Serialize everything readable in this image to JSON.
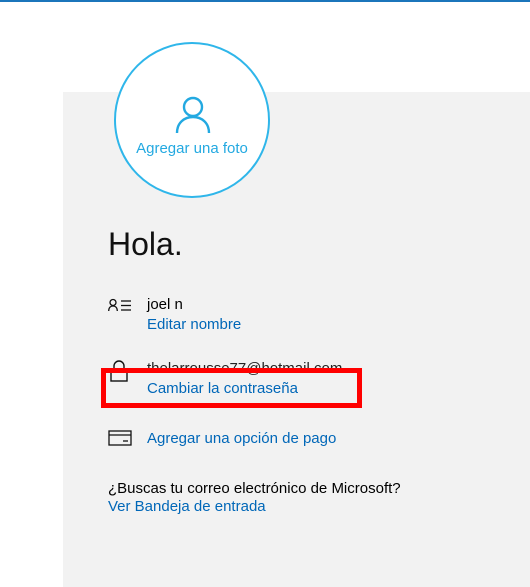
{
  "greeting": "Hola.",
  "avatar": {
    "label": "Agregar una foto",
    "icon": "person-icon"
  },
  "profile": {
    "name": "joel n",
    "edit_name_link": "Editar nombre",
    "email": "thelarrousse77@hotmail.com",
    "change_password_link": "Cambiar la contraseña",
    "add_payment_link": "Agregar una opción de pago"
  },
  "mail": {
    "question": "¿Buscas tu correo electrónico de Microsoft?",
    "inbox_link": "Ver Bandeja de entrada"
  },
  "icons": {
    "name": "contact-card-icon",
    "password": "lock-icon",
    "payment": "credit-card-icon"
  },
  "colors": {
    "accent": "#23a9e1",
    "link": "#0067b8",
    "highlight": "#ff0000",
    "card_bg": "#f2f2f2"
  }
}
